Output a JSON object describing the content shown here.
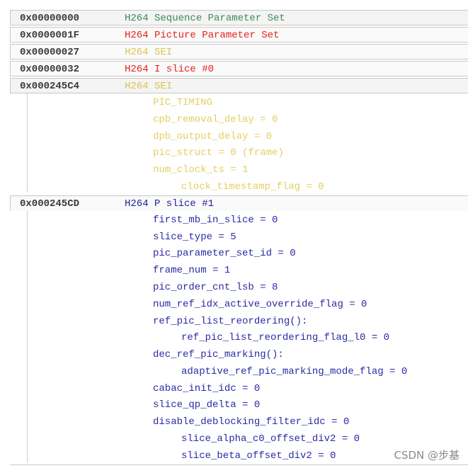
{
  "entries": [
    {
      "address": "0x00000000",
      "label": "H264 Sequence Parameter Set",
      "color": "#3c8a5a"
    },
    {
      "address": "0x0000001F",
      "label": "H264 Picture Parameter Set",
      "color": "#e8201a"
    },
    {
      "address": "0x00000027",
      "label": "H264 SEI",
      "color": "#d9c44f"
    },
    {
      "address": "0x00000032",
      "label": "H264 I slice #0",
      "color": "#e8201a"
    },
    {
      "address": "0x000245C4",
      "label": "H264 SEI",
      "color": "#d9c44f"
    },
    {
      "address": "0x000245CD",
      "label": "H264 P slice #1",
      "color": "#1f1f9e"
    }
  ],
  "sei_fields": [
    "PIC_TIMING",
    "cpb_removal_delay = 0",
    "dpb_output_delay = 0",
    "pic_struct = 0 (frame)",
    "num_clock_ts = 1",
    "clock_timestamp_flag = 0"
  ],
  "p_slice_fields": [
    "first_mb_in_slice = 0",
    "slice_type = 5",
    "pic_parameter_set_id = 0",
    "frame_num = 1",
    "pic_order_cnt_lsb = 8",
    "num_ref_idx_active_override_flag = 0",
    "ref_pic_list_reordering():",
    "ref_pic_list_reordering_flag_l0 = 0",
    "dec_ref_pic_marking():",
    "adaptive_ref_pic_marking_mode_flag = 0",
    "cabac_init_idc = 0",
    "slice_qp_delta = 0",
    "disable_deblocking_filter_idc = 0",
    "slice_alpha_c0_offset_div2 = 0",
    "slice_beta_offset_div2 = 0"
  ],
  "watermark": "CSDN @步基"
}
